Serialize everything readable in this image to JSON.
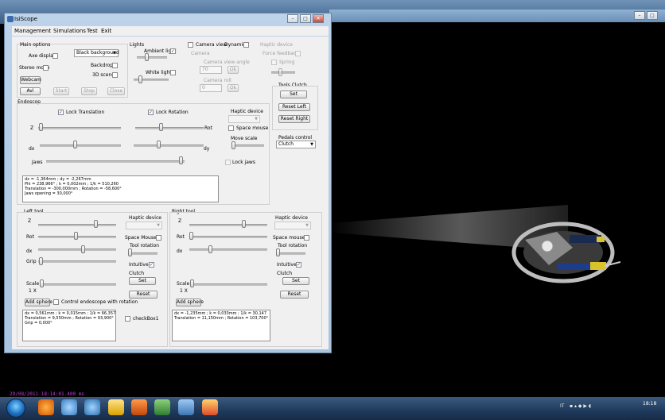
{
  "window": {
    "title": "IsiScope"
  },
  "menu": [
    "Management",
    "Simulations",
    "Test",
    "Exit"
  ],
  "main_options": {
    "title": "Main options",
    "axe_display": "Axe display",
    "stereo_mode": "Stereo mode",
    "background_select": "Black background",
    "backdrop": "Backdrop",
    "scene_3d": "3D scene",
    "webcam": "Webcam",
    "avi": "Avi",
    "start": "Start",
    "stop": "Stop",
    "close": "Close"
  },
  "lights": {
    "title": "Lights",
    "ambient": "Ambient light",
    "white": "White lights"
  },
  "camera": {
    "camera_view": "Camera view",
    "dynamic": "Dynamic",
    "camera_label": "Camera",
    "view_angle": "Camera view angle",
    "angle_value": "70",
    "ok1": "Ok",
    "roll": "Camera roll",
    "roll_value": "0",
    "ok2": "Ok"
  },
  "haptic_device_top": {
    "title": "Haptic device",
    "force_feedback": "Force feedback",
    "spring": "Spring"
  },
  "tools_clutch": {
    "title": "Tools Clutch",
    "set": "Set",
    "reset_left": "Reset Left",
    "reset_right": "Reset Right"
  },
  "endoscope": {
    "title": "Endoscop",
    "lock_translation": "Lock Translation",
    "lock_rotation": "Lock Rotation",
    "z": "Z",
    "rot": "Rot",
    "dx": "dx",
    "dy": "dy",
    "jaws": "Jaws",
    "lock_jaws": "Lock jaws",
    "haptic_device": "Haptic device",
    "space_mouse": "Space mouse",
    "move_scale": "Move scale",
    "pedals_control": "Pedals control",
    "pedals_value": "Clutch",
    "info": "dx = -1,364mm ; dy = -2,267mm\nPhi = 238,966° ; k = 0,002mm ; 1/k = 510,260\nTranslation = -300,000mm ; Rotation = -58,600°\nJaws opening = 30,000°"
  },
  "left_tool": {
    "title": "Left tool",
    "z": "Z",
    "rot": "Rot",
    "dx": "dx",
    "grip": "Grip",
    "scale": "Scale",
    "scale_value": "1 X",
    "haptic_device": "Haptic device",
    "space_mouse": "Space Mouse",
    "tool_rotation": "Tool rotation",
    "intuitive": "Intuitive",
    "clutch": "Clutch",
    "set": "Set",
    "reset": "Reset",
    "add_sphere": "Add sphere",
    "control_endoscope": "Control endoscope with rotation",
    "info": "dx = 0,561mm ; k = 0,015mm ; 1/k = 66,357\nTranslation = 9,550mm ; Rotation = 93,900°\nGrip = 0,000°",
    "checkbox1": "checkBox1"
  },
  "right_tool": {
    "title": "Right tool",
    "z": "Z",
    "rot": "Rot",
    "dx": "dx",
    "scale": "Scale",
    "scale_value": "1 X",
    "haptic_device": "Haptic device",
    "space_mouse": "Space mouse",
    "tool_rotation": "Tool rotation",
    "intuitive": "Intuitive",
    "clutch": "Clutch",
    "set": "Set",
    "reset": "Reset",
    "add_sphere": "Add sphere",
    "info": "dx = -1,235mm ; k = 0,033mm ; 1/k = 30,147\nTranslation = 11,150mm ; Rotation = 103,700°"
  },
  "render_view": {
    "timestamp": "29/08/2011 18:14:01.400 ms"
  },
  "taskbar": {
    "lang": "IT",
    "clock": "18:18"
  },
  "colors": {
    "accent": "#1a4aa0",
    "timestamp": "#c23bd6",
    "client_bg": "#f0f0f0"
  }
}
